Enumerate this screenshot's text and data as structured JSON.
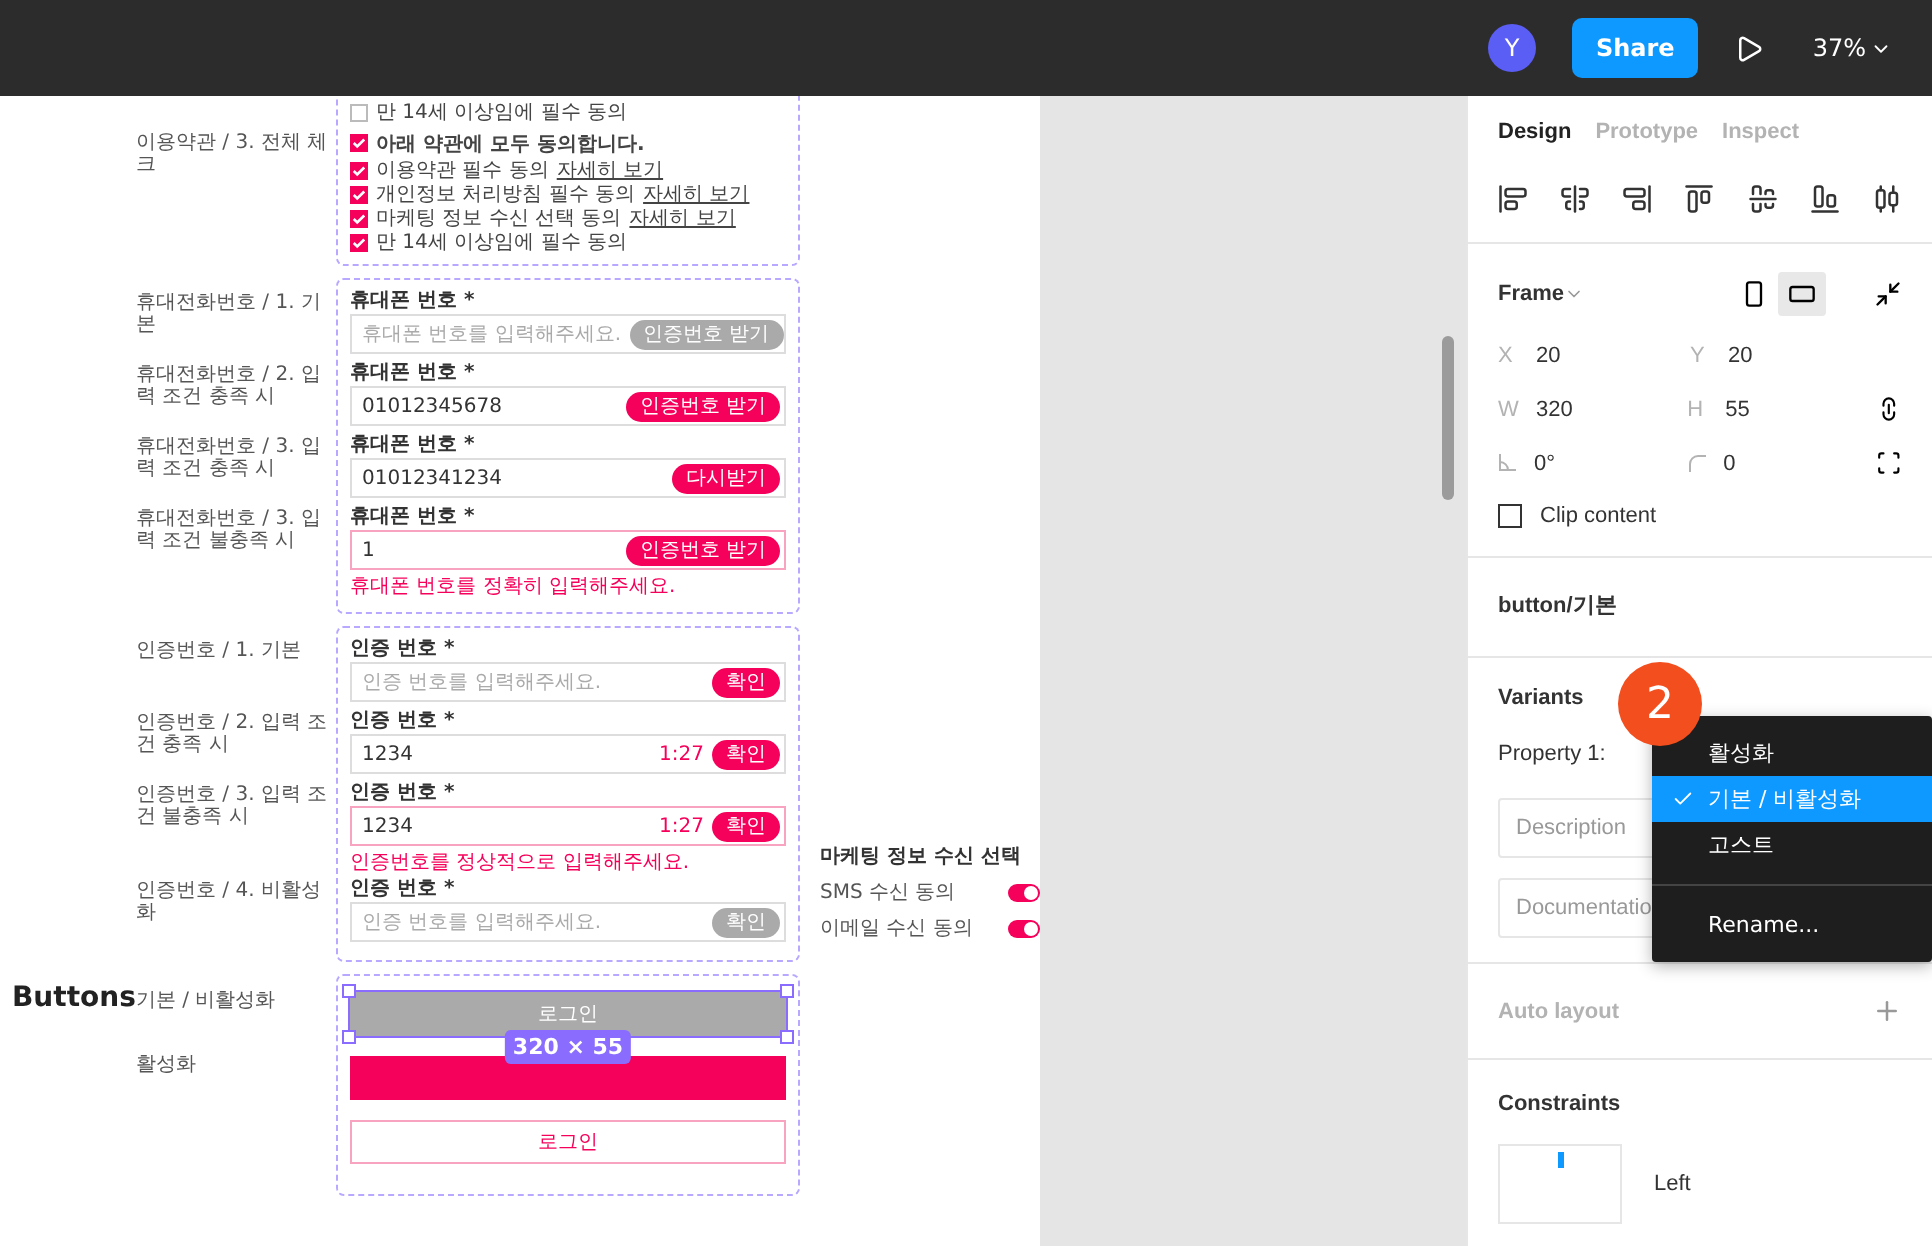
{
  "toolbar": {
    "avatar": "Y",
    "share": "Share",
    "zoom": "37%"
  },
  "agreement": {
    "side_label": "이용약관 / 3. 전체 체크",
    "pre_items": [
      {
        "label": "만 14세 이상임에 필수 동의",
        "checked": false
      }
    ],
    "all": {
      "label": "아래 약관에 모두 동의합니다.",
      "checked": true
    },
    "items": [
      {
        "label": "이용약관 필수 동의",
        "link": "자세히 보기",
        "checked": true
      },
      {
        "label": "개인정보 처리방침 필수 동의",
        "link": "자세히 보기",
        "checked": true
      },
      {
        "label": "마케팅 정보 수신 선택 동의",
        "link": "자세히 보기",
        "checked": true
      },
      {
        "label": "만 14세 이상임에 필수 동의",
        "checked": true
      }
    ]
  },
  "phone_fields": [
    {
      "side_label": "휴대전화번호 / 1. 기본",
      "label": "휴대폰 번호 *",
      "placeholder": "휴대폰 번호를 입력해주세요.",
      "button": "인증번호 받기",
      "button_active": false,
      "invalid": false
    },
    {
      "side_label": "휴대전화번호 / 2. 입력 조건 충족 시",
      "label": "휴대폰 번호 *",
      "value": "01012345678",
      "button": "인증번호 받기",
      "button_active": true,
      "invalid": false
    },
    {
      "side_label": "휴대전화번호 / 3. 입력 조건 충족 시",
      "label": "휴대폰 번호 *",
      "value": "01012341234",
      "button": "다시받기",
      "button_active": true,
      "invalid": false
    },
    {
      "side_label": "휴대전화번호 / 3. 입력 조건 불충족 시",
      "label": "휴대폰 번호 *",
      "value": "1",
      "button": "인증번호 받기",
      "button_active": true,
      "invalid": true,
      "error": "휴대폰 번호를 정확히 입력해주세요."
    }
  ],
  "auth_fields": [
    {
      "side_label": "인증번호 / 1. 기본",
      "label": "인증 번호 *",
      "placeholder": "인증 번호를 입력해주세요.",
      "button": "확인",
      "button_active": true,
      "invalid": false
    },
    {
      "side_label": "인증번호 / 2. 입력 조건 충족 시",
      "label": "인증 번호 *",
      "value": "1234",
      "timer": "1:27",
      "button": "확인",
      "button_active": true,
      "invalid": false
    },
    {
      "side_label": "인증번호 / 3. 입력 조건 불충족 시",
      "label": "인증 번호 *",
      "value": "1234",
      "timer": "1:27",
      "button": "확인",
      "button_active": true,
      "invalid": true,
      "error": "인증번호를 정상적으로 입력해주세요."
    },
    {
      "side_label": "인증번호 / 4. 비활성화",
      "label": "인증 번호 *",
      "placeholder": "인증 번호를 입력해주세요.",
      "button": "확인",
      "button_active": false,
      "invalid": false
    }
  ],
  "marketing": {
    "title": "마케팅 정보 수신 선택",
    "toggles": [
      {
        "label": "SMS 수신 동의",
        "on": true
      },
      {
        "label": "이메일 수신 동의",
        "on": true
      }
    ]
  },
  "buttons_section": {
    "heading": "Buttons",
    "side_labels": [
      "기본 / 비활성화",
      "활성화"
    ],
    "size_badge": "320 × 55",
    "buttons": [
      {
        "kind": "disabled",
        "label": "로그인",
        "selected": true
      },
      {
        "kind": "filled",
        "selected": false
      },
      {
        "kind": "ghost",
        "label": "로그인",
        "selected": false
      }
    ]
  },
  "panel": {
    "tabs": [
      {
        "label": "Design",
        "selected": true
      },
      {
        "label": "Prototype",
        "selected": false
      },
      {
        "label": "Inspect",
        "selected": false
      }
    ],
    "frame": {
      "title": "Frame",
      "orientations": [
        {
          "kind": "portrait",
          "selected": false
        },
        {
          "kind": "landscape",
          "selected": true
        }
      ],
      "props": [
        {
          "label": "X",
          "value": "20"
        },
        {
          "label": "Y",
          "value": "20"
        },
        {
          "label": "W",
          "value": "320"
        },
        {
          "label": "H",
          "value": "55"
        },
        {
          "kind": "rotation",
          "value": "0°"
        },
        {
          "kind": "radius",
          "value": "0"
        }
      ],
      "clip_content": {
        "label": "Clip content",
        "checked": false
      }
    },
    "component_name": "button/기본",
    "variants": {
      "title": "Variants",
      "property": "Property 1:",
      "description_placeholder": "Description",
      "documentation_placeholder": "Documentatio"
    },
    "auto_layout": "Auto layout",
    "constraints": {
      "title": "Constraints",
      "horizontal": "Left"
    }
  },
  "step_badge": "2",
  "menu": {
    "items": [
      {
        "label": "활성화",
        "selected": false
      },
      {
        "label": "기본 / 비활성화",
        "selected": true
      },
      {
        "label": "고스트",
        "selected": false
      }
    ],
    "rename": "Rename..."
  }
}
